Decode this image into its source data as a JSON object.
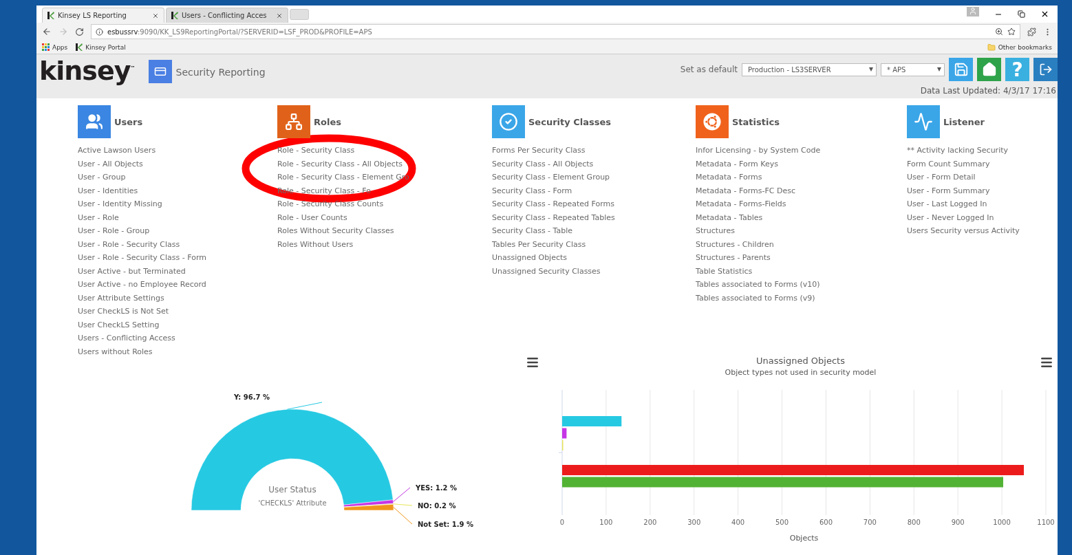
{
  "browser": {
    "tabs": [
      {
        "title": "Kinsey LS Reporting",
        "selected": true
      },
      {
        "title": "Users - Conflicting Acces",
        "selected": false
      }
    ],
    "url_host": "esbussrv",
    "url_rest": ":9090/KK_LS9ReportingPortal/?SERVERID=LSF_PROD&PROFILE=APS",
    "bookmarks": [
      {
        "label": "Apps",
        "kind": "apps"
      },
      {
        "label": "Kinsey Portal",
        "kind": "site"
      }
    ],
    "other_bookmarks": "Other bookmarks"
  },
  "header": {
    "logo": "kinsey",
    "logo_mark": "™",
    "app_title": "Security Reporting",
    "default_label": "Set as default",
    "server_select": "Production - LS3SERVER",
    "profile_select": "* APS",
    "help": "?",
    "updated": "Data Last Updated: 4/3/17 17:16"
  },
  "sections": [
    {
      "title": "Users",
      "kind": "users",
      "links": [
        "Active Lawson Users",
        "User - All Objects",
        "User - Group",
        "User - Identities",
        "User - Identity Missing",
        "User - Role",
        "User - Role - Group",
        "User - Role - Security Class",
        "User - Role - Security Class - Form",
        "User Active - but Terminated",
        "User Active - no Employee Record",
        "User Attribute Settings",
        "User CheckLS is Not Set",
        "User CheckLS Setting",
        "Users - Conflicting Access",
        "Users without Roles"
      ]
    },
    {
      "title": "Roles",
      "kind": "roles",
      "links": [
        "Role - Security Class",
        "Role - Security Class - All Objects",
        "Role - Security Class - Element Gro",
        "Role - Security Class - Fo",
        "Role - Security Class Counts",
        "Role - User Counts",
        "Roles Without Security Classes",
        "Roles Without Users"
      ]
    },
    {
      "title": "Security Classes",
      "kind": "classes",
      "links": [
        "Forms Per Security Class",
        "Security Class - All Objects",
        "Security Class - Element Group",
        "Security Class - Form",
        "Security Class - Repeated Forms",
        "Security Class - Repeated Tables",
        "Security Class - Table",
        "Tables Per Security Class",
        "Unassigned Objects",
        "Unassigned Security Classes"
      ]
    },
    {
      "title": "Statistics",
      "kind": "statistics",
      "links": [
        "Infor Licensing - by System Code",
        "Metadata - Form Keys",
        "Metadata - Forms",
        "Metadata - Forms-FC Desc",
        "Metadata - Forms-Fields",
        "Metadata - Tables",
        "Structures",
        "Structures - Children",
        "Structures - Parents",
        "Table Statistics",
        "Tables associated to Forms (v10)",
        "Tables associated to Forms (v9)"
      ]
    },
    {
      "title": "Listener",
      "kind": "listener",
      "links": [
        "** Activity lacking Security",
        "Form Count Summary",
        "User - Form Detail",
        "User - Form Summary",
        "User - Last Logged In",
        "User - Never Logged In",
        "Users Security versus Activity"
      ]
    }
  ],
  "annotation": {
    "kind": "ellipse"
  },
  "user_status_chart": {
    "chart_data": {
      "type": "donut",
      "title": "User Status",
      "subtitle": "'CHECKLS' Attribute",
      "series": [
        {
          "values": [
            96.7,
            1.2,
            0.2,
            1.9
          ]
        }
      ],
      "colors": [
        "#26c9e2",
        "#c635e6",
        "#e8e65a",
        "#f0961c"
      ],
      "annotations": [
        {
          "text": "Y: 96.7 %"
        },
        {
          "text": "YES: 1.2 %"
        },
        {
          "text": "NO: 0.2 %"
        },
        {
          "text": "Not Set: 1.9 %"
        }
      ]
    }
  },
  "unassigned_chart": {
    "chart_data": {
      "type": "bar",
      "orientation": "horizontal",
      "title": "Unassigned Objects",
      "subtitle": "Object types not used in security model",
      "xlabel": "Objects",
      "xlim": [
        0,
        1100
      ],
      "xticks": [
        0,
        100,
        200,
        300,
        400,
        500,
        600,
        700,
        800,
        900,
        1000,
        1100
      ],
      "grid": true,
      "series": [
        {
          "color": "#26c9e2",
          "values": [
            135,
            null
          ]
        },
        {
          "color": "#c635e6",
          "values": [
            10,
            null
          ]
        },
        {
          "color": "#e8e65a",
          "values": [
            2,
            null
          ]
        },
        {
          "color": "#ed1c1c",
          "values": [
            null,
            1050
          ]
        },
        {
          "color": "#52b234",
          "values": [
            null,
            1003
          ]
        }
      ]
    }
  }
}
